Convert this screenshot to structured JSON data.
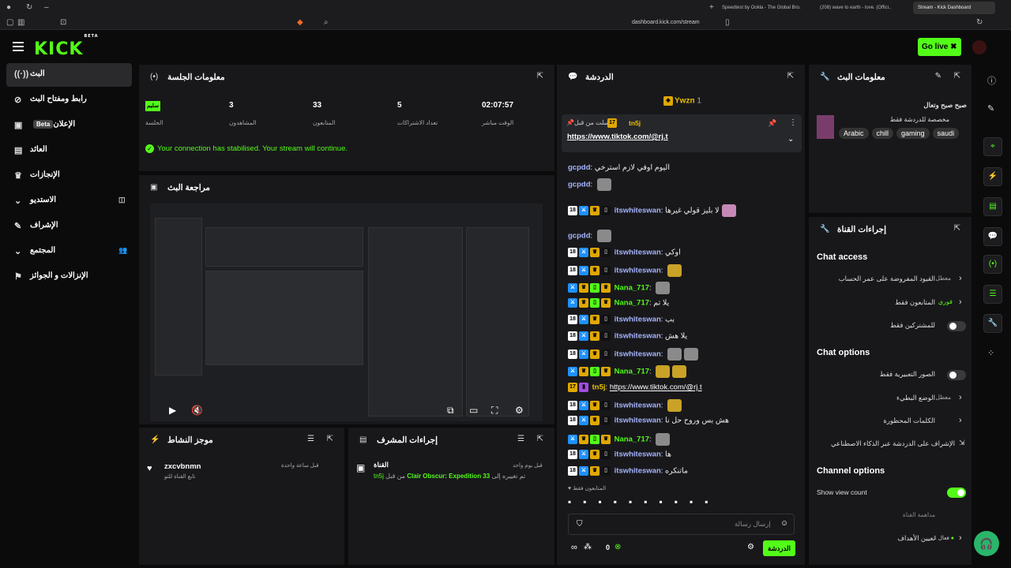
{
  "browser": {
    "tabs": [
      {
        "label": "Speedtest by Ookla - The Global Bro..."
      },
      {
        "label": "(208) wave to earth - love. (Offici..."
      },
      {
        "label": "Stream - Kick Dashboard"
      }
    ],
    "url": "dashboard.kick.com/stream"
  },
  "header": {
    "logo": "KICK",
    "logo_beta": "BETA",
    "go_live": "Go live"
  },
  "sidebar": {
    "items": [
      {
        "label": "البث",
        "icon": "broadcast-icon"
      },
      {
        "label": "رابط ومفتاح البث",
        "icon": "link-icon"
      },
      {
        "label": "الإعلان",
        "badge": "Beta",
        "icon": "ad-icon"
      },
      {
        "label": "العائد",
        "icon": "revenue-icon"
      },
      {
        "label": "الإنجازات",
        "icon": "trophy-icon"
      },
      {
        "label": "الاستديو",
        "icon": "studio-icon"
      },
      {
        "label": "الإشراف",
        "icon": "wrench-icon"
      },
      {
        "label": "المجتمع",
        "icon": "community-icon"
      },
      {
        "label": "الإنزالات و الجوائز",
        "icon": "drops-icon"
      }
    ]
  },
  "session": {
    "title": "معلومات الجلسة",
    "stats": [
      {
        "value": "سليم",
        "label": "الجلسة"
      },
      {
        "value": "3",
        "label": "المشاهدون"
      },
      {
        "value": "33",
        "label": "المتابعون"
      },
      {
        "value": "5",
        "label": "تعداد الاشتراكات"
      },
      {
        "value": "02:07:57",
        "label": "الوقت مباشر"
      }
    ],
    "notice": "Your connection has stabilised. Your stream will continue."
  },
  "preview": {
    "title": "مراجعة البث"
  },
  "activity": {
    "title": "موجز النشاط",
    "item_name": "zxcvbnmn",
    "item_sub": "تابع القناة للتو",
    "item_time": "قبل ساعة واحدة"
  },
  "mod_actions": {
    "title": "إجراءات المشرف",
    "item_title": "القناة",
    "item_time": "قبل يوم واحد",
    "item_text": "تم تغييره إلى",
    "item_game": "Clair Obscur: Expedition 33",
    "item_from": "من قبل",
    "item_user": "tn5j"
  },
  "chat": {
    "title": "الدردشة",
    "top_user": "Ywzn",
    "top_count": "1",
    "pinned_by": "أرسلت من قبل",
    "pinned_user": "tn5j",
    "pinned_badge": "17",
    "pinned_link": "https://www.tiktok.com/@rj.t",
    "messages": [
      {
        "user": "gcpdd",
        "text": "اليوم اوفي لازم استرخي"
      },
      {
        "user": "gcpdd",
        "text": ""
      },
      {
        "user": "itswhiteswan",
        "text": "لا بليز قولي غيرها"
      },
      {
        "user": "gcpdd",
        "text": ""
      },
      {
        "user": "itswhiteswan",
        "text": "اوكي"
      },
      {
        "user": "itswhiteswan",
        "text": ""
      },
      {
        "user": "Nana_717",
        "text": ""
      },
      {
        "user": "Nana_717",
        "text": "يلا تم"
      },
      {
        "user": "itswhiteswan",
        "text": "بب"
      },
      {
        "user": "itswhiteswan",
        "text": "يلا هش"
      },
      {
        "user": "itswhiteswan",
        "text": ""
      },
      {
        "user": "Nana_717",
        "text": ""
      },
      {
        "user": "tn5j",
        "text": "https://www.tiktok.com/@rj.t"
      },
      {
        "user": "itswhiteswan",
        "text": ""
      },
      {
        "user": "itswhiteswan",
        "text": "هش بس وروح حل نا"
      },
      {
        "user": "Nana_717",
        "text": ""
      },
      {
        "user": "itswhiteswan",
        "text": "ها"
      },
      {
        "user": "itswhiteswan",
        "text": "ماتنكره"
      }
    ],
    "followers_only": "المتابعون فقط",
    "input_placeholder": "إرسال رسالة",
    "send": "الدردشة",
    "count": "0"
  },
  "stream_info": {
    "title": "معلومات البث",
    "stream_title": "صبح صبح وتعال",
    "category": "مخصصة للدردشة فقط",
    "tags": [
      "Arabic",
      "chill",
      "gaming",
      "saudi"
    ]
  },
  "channel_actions": {
    "title": "إجراءات القناة",
    "chat_access": "Chat access",
    "rows_access": [
      {
        "label": "القيود المفروضة على عمر الحساب",
        "value": "معطل"
      },
      {
        "label": "المتابعون فقط",
        "value": "فوري"
      },
      {
        "label": "للمشتركين فقط",
        "value": ""
      }
    ],
    "chat_options": "Chat options",
    "rows_options": [
      {
        "label": "الصور التعبيرية فقط",
        "value": ""
      },
      {
        "label": "الوضع البطيء",
        "value": "معطل"
      },
      {
        "label": "الكلمات المحظورة",
        "value": ""
      },
      {
        "label": "الإشراف على الدردشة عبر الذكاء الاصطناعي",
        "value": ""
      }
    ],
    "channel_options": "Channel options",
    "show_view_count": "Show view count",
    "host_label": "مداهمة القناة",
    "goals": "تعيين الأهداف",
    "goals_value": "فعال 1"
  },
  "colors": {
    "accent": "#53fc18",
    "panel": "#18181b",
    "bg": "#0b0b0b"
  }
}
